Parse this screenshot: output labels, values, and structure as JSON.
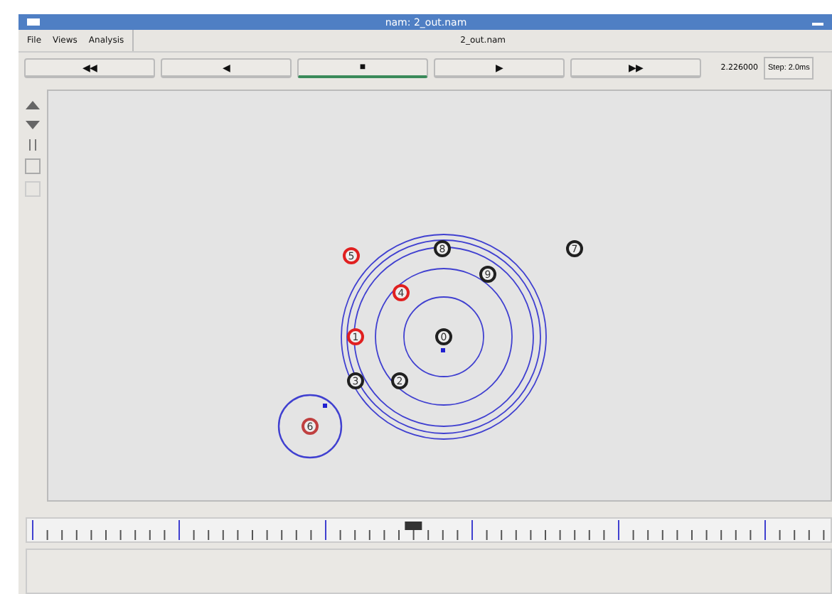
{
  "window": {
    "title": "nam: 2_out.nam"
  },
  "menu": [
    "File",
    "Views",
    "Analysis"
  ],
  "file_label": "2_out.nam",
  "transport": [
    {
      "label": "◀◀",
      "selected": false
    },
    {
      "label": "◀",
      "selected": false
    },
    {
      "label": "■",
      "selected": true
    },
    {
      "label": "▶",
      "selected": false
    },
    {
      "label": "▶▶",
      "selected": false
    }
  ],
  "time": "2.226000",
  "step": "Step: 2.0ms",
  "timeline": {
    "level": 0.48
  },
  "nodes": [
    {
      "label": "5",
      "color": "#e02020"
    },
    {
      "label": "8",
      "color": "#202020"
    },
    {
      "label": "9",
      "color": "#202020"
    },
    {
      "label": "7",
      "color": "#202020"
    },
    {
      "label": "4",
      "color": "#e02020"
    },
    {
      "label": "1",
      "color": "#e02020"
    },
    {
      "label": "0",
      "color": "#202020"
    },
    {
      "label": "3",
      "color": "#202020"
    },
    {
      "label": "2",
      "color": "#202020"
    },
    {
      "label": "6",
      "color": "#c04040"
    }
  ]
}
